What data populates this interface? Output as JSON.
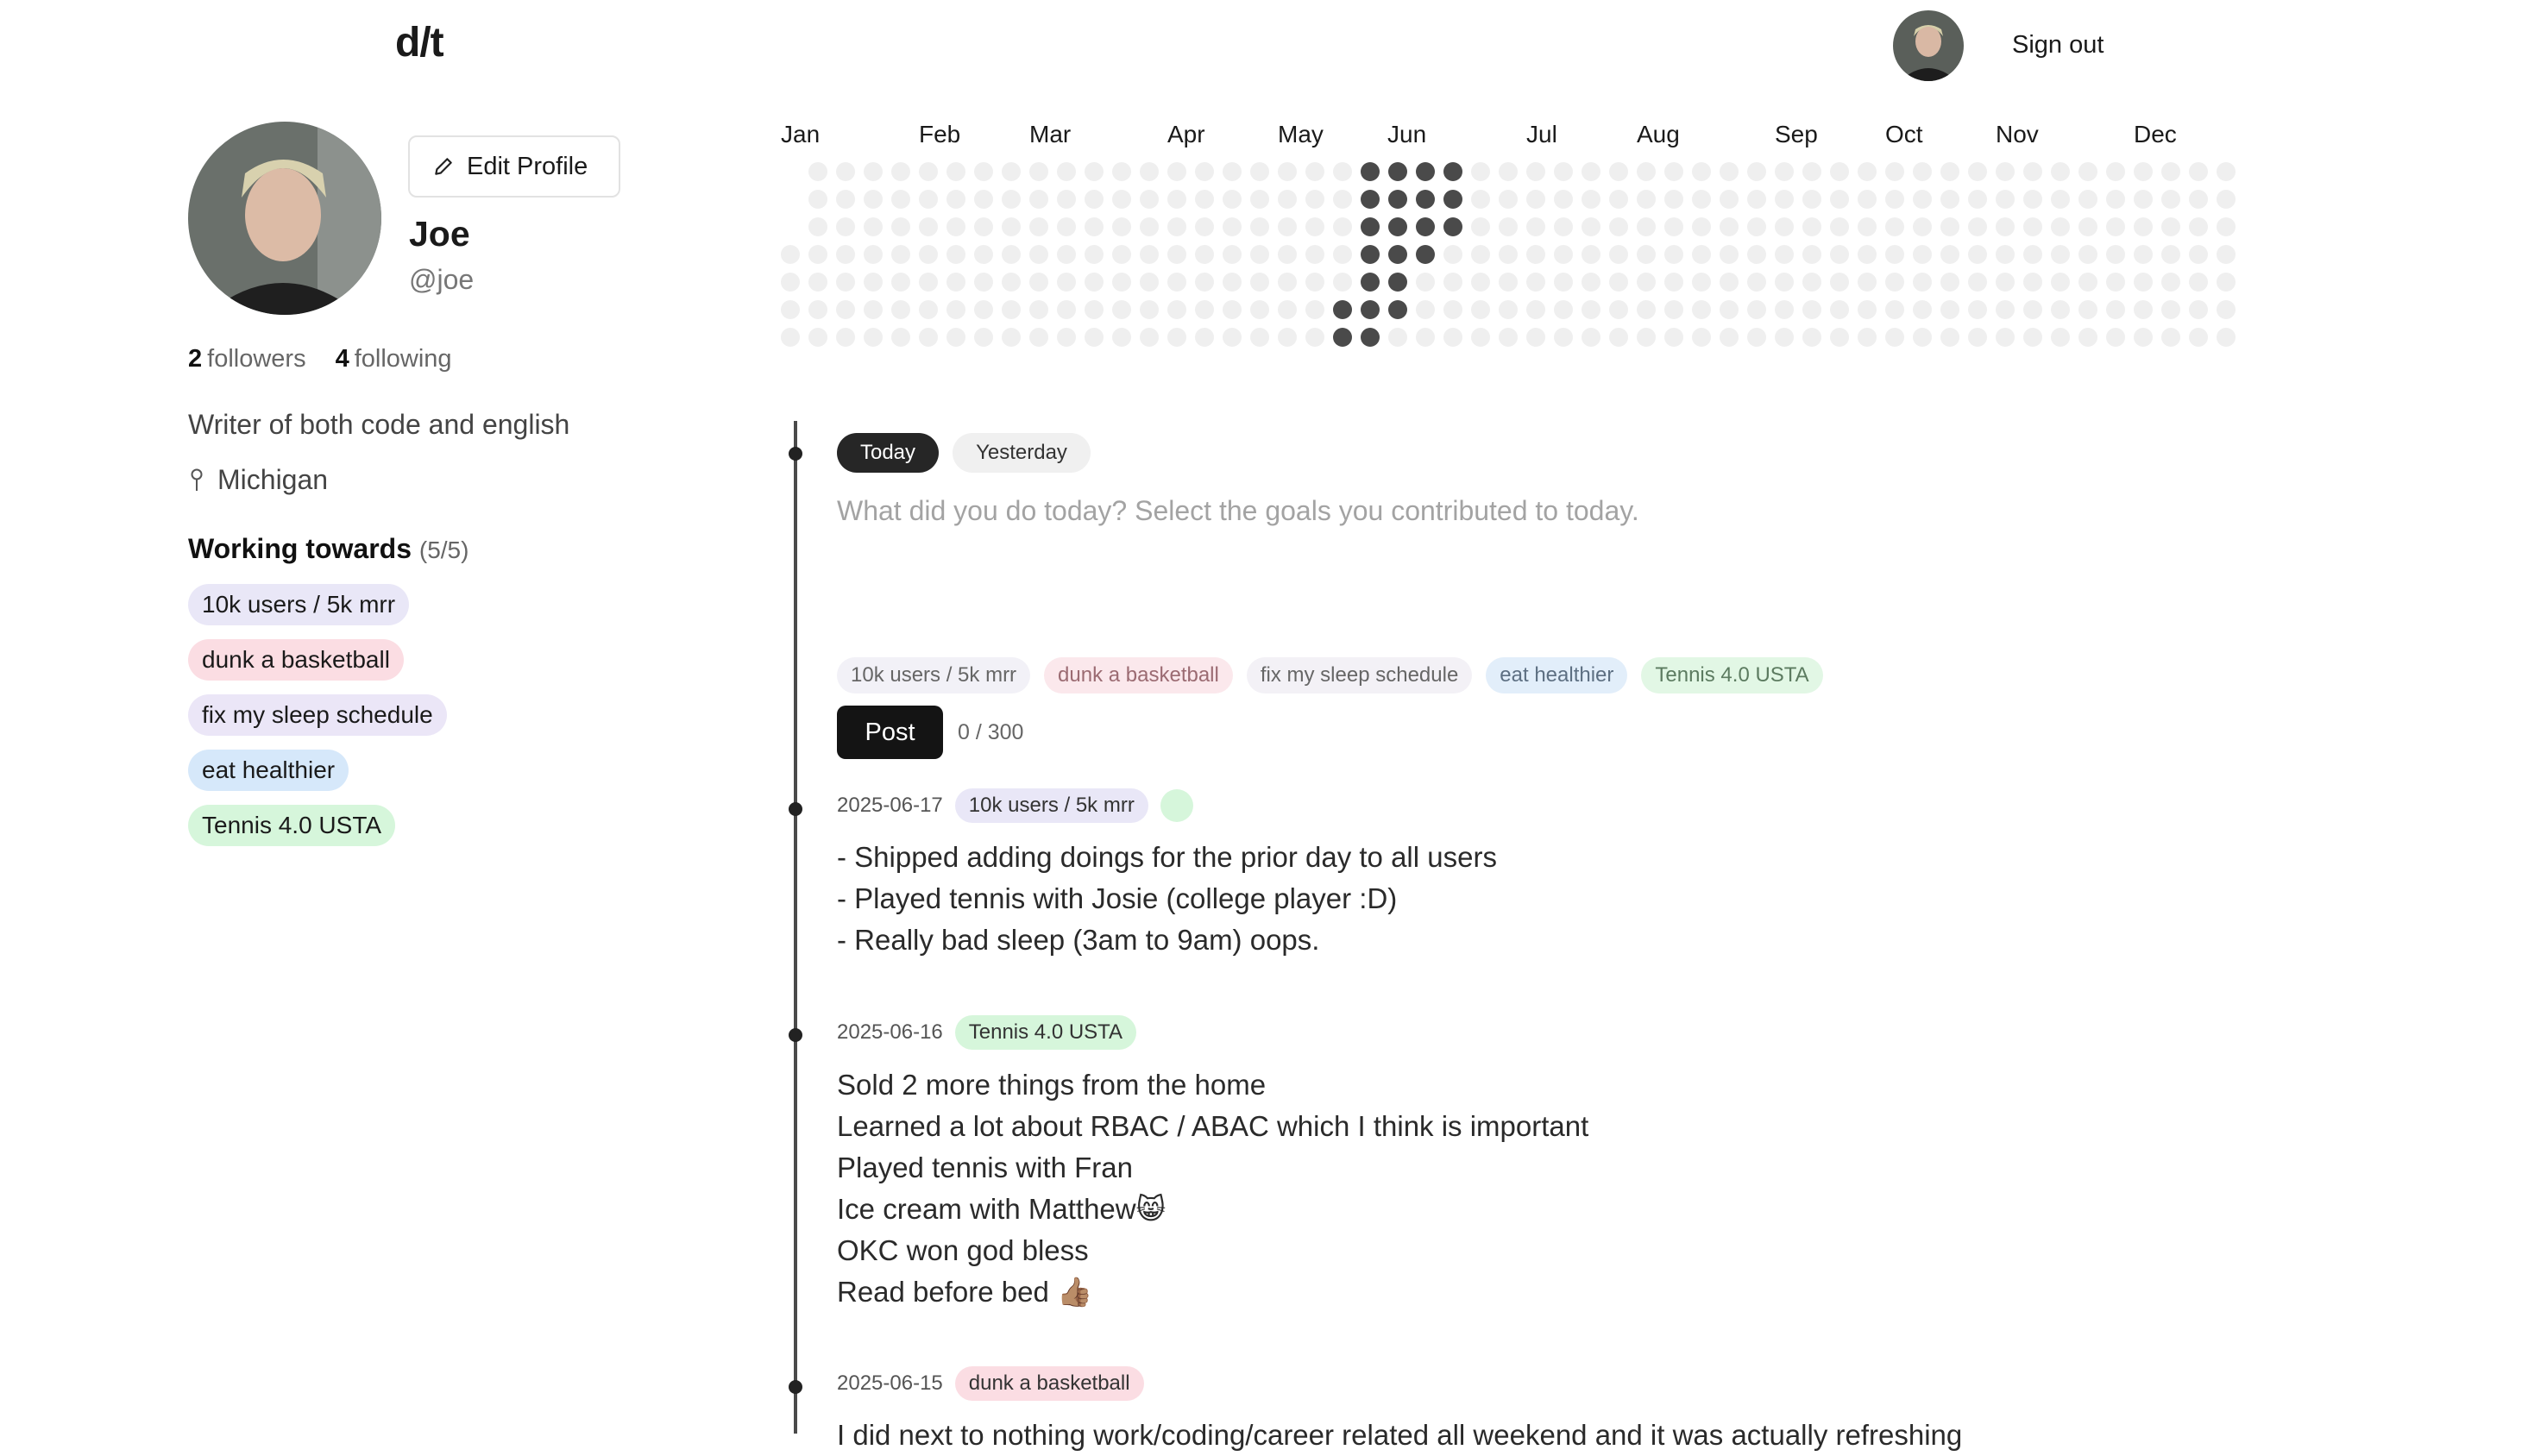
{
  "header": {
    "logo": "d/t",
    "sign_out": "Sign out"
  },
  "profile": {
    "edit_label": "Edit Profile",
    "name": "Joe",
    "handle": "@joe",
    "followers_count": "2",
    "followers_label": "followers",
    "following_count": "4",
    "following_label": "following",
    "bio": "Writer of both code and english",
    "location": "Michigan",
    "working_towards_label": "Working towards",
    "working_towards_count": "(5/5)",
    "goals": [
      "10k users / 5k mrr",
      "dunk a basketball",
      "fix my sleep schedule",
      "eat healthier",
      "Tennis 4.0 USTA"
    ]
  },
  "heatmap": {
    "months": [
      "Jan",
      "Feb",
      "Mar",
      "Apr",
      "May",
      "Jun",
      "Jul",
      "Aug",
      "Sep",
      "Oct",
      "Nov",
      "Dec"
    ]
  },
  "composer": {
    "tab_today": "Today",
    "tab_yesterday": "Yesterday",
    "placeholder": "What did you do today? Select the goals you contributed to today.",
    "goal_chips": [
      "10k users / 5k mrr",
      "dunk a basketball",
      "fix my sleep schedule",
      "eat healthier",
      "Tennis 4.0 USTA"
    ],
    "post_label": "Post",
    "char_count": "0 / 300"
  },
  "entries": [
    {
      "date": "2025-06-17",
      "tag": "10k users / 5k mrr",
      "lines": [
        "- Shipped adding doings for the prior day to all users",
        "- Played tennis with Josie (college player :D)",
        "- Really bad sleep (3am to 9am) oops."
      ]
    },
    {
      "date": "2025-06-16",
      "tag": "Tennis 4.0 USTA",
      "lines": [
        "Sold 2 more things from the home",
        "Learned a lot about RBAC / ABAC which I think is important",
        "Played tennis with Fran",
        "Ice cream with Matthew😸",
        "OKC won god bless",
        "Read before bed 👍🏽"
      ]
    },
    {
      "date": "2025-06-15",
      "tag": "dunk a basketball",
      "lines": [
        "I did next to nothing work/coding/career related all weekend and it was actually refreshing"
      ]
    }
  ]
}
